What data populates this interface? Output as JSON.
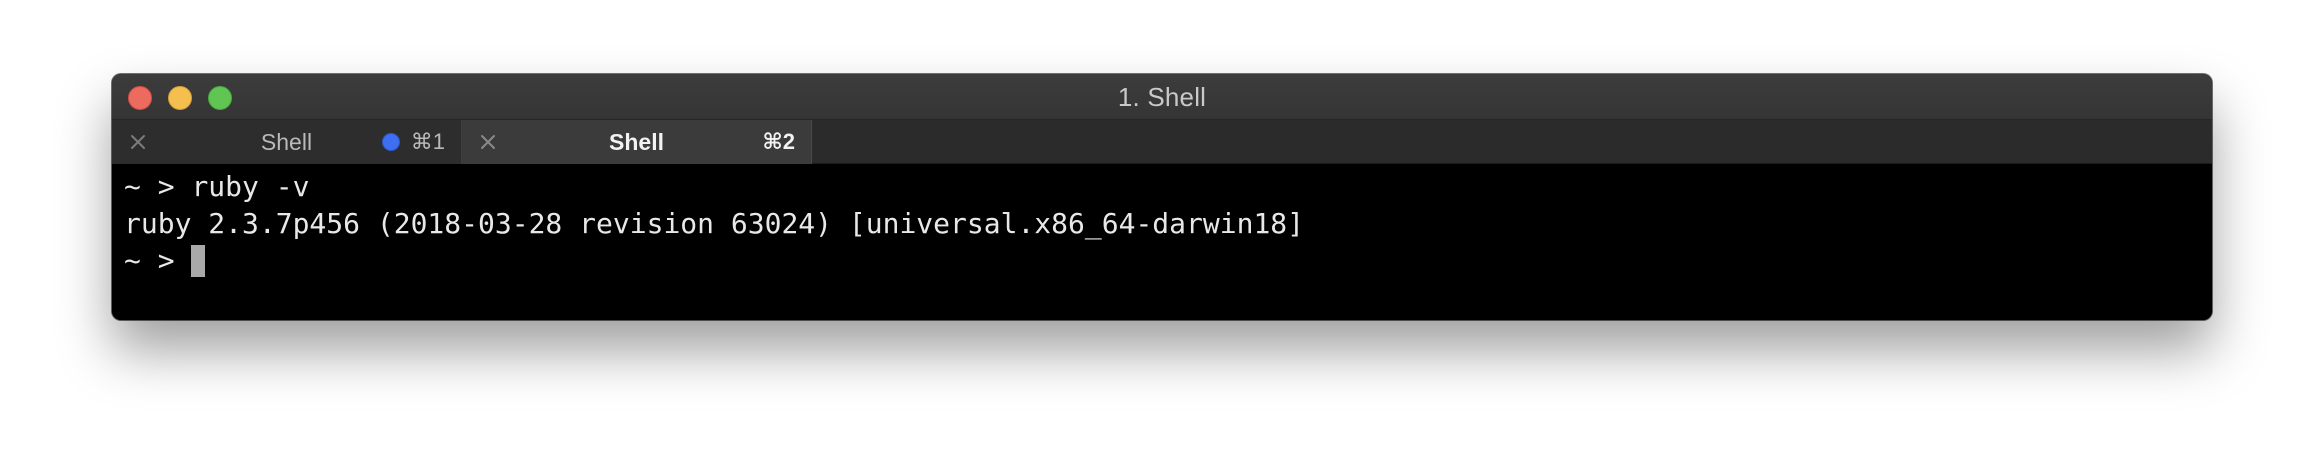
{
  "window": {
    "title": "1. Shell",
    "colors": {
      "close": "#ed6a5e",
      "minimize": "#f4bf4f",
      "zoom": "#61c554"
    }
  },
  "tabs": [
    {
      "label": "Shell",
      "shortcut": "⌘1",
      "active": false,
      "activity_indicator": true,
      "indicator_color": "#3d6ff0",
      "close_icon": "close-icon"
    },
    {
      "label": "Shell",
      "shortcut": "⌘2",
      "active": true,
      "activity_indicator": false,
      "close_icon": "close-icon"
    }
  ],
  "terminal": {
    "lines": [
      {
        "prompt": "~ > ",
        "text": "ruby -v"
      },
      {
        "prompt": "",
        "text": "ruby 2.3.7p456 (2018-03-28 revision 63024) [universal.x86_64-darwin18]"
      },
      {
        "prompt": "~ > ",
        "text": ""
      }
    ],
    "cursor": "block-cursor"
  }
}
